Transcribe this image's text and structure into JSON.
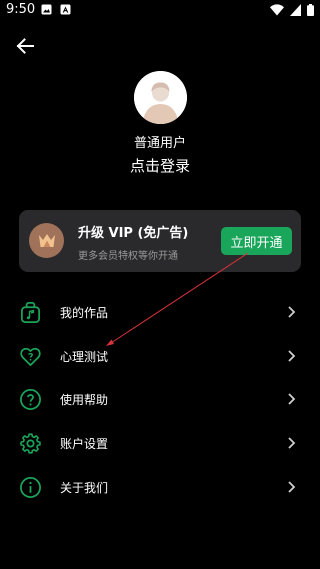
{
  "status_bar": {
    "time": "9:50"
  },
  "profile": {
    "user_type": "普通用户",
    "login_text": "点击登录"
  },
  "vip": {
    "title": "升级 VIP (免广告)",
    "subtitle": "更多会员特权等你开通",
    "button_label": "立即开通"
  },
  "menu": {
    "items": [
      {
        "label": "我的作品",
        "icon": "music-bag-icon"
      },
      {
        "label": "心理测试",
        "icon": "heart-test-icon"
      },
      {
        "label": "使用帮助",
        "icon": "help-icon"
      },
      {
        "label": "账户设置",
        "icon": "gear-icon"
      },
      {
        "label": "关于我们",
        "icon": "info-icon"
      }
    ]
  },
  "colors": {
    "accent": "#1aa65a",
    "background": "#000000",
    "card": "#2a2a2c",
    "annotation_arrow": "#d8333a"
  }
}
